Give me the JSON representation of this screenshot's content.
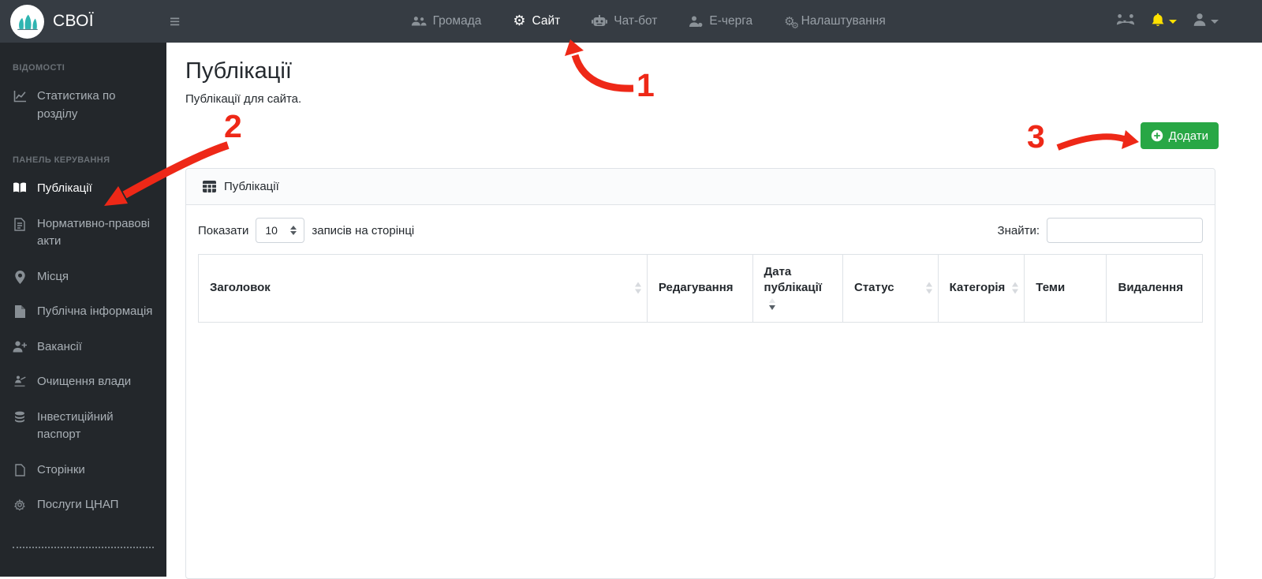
{
  "navbar": {
    "brand": "СВОЇ",
    "items": [
      {
        "label": "Громада",
        "icon": "people-icon",
        "active": false
      },
      {
        "label": "Сайт",
        "icon": "gear-icon",
        "active": true
      },
      {
        "label": "Чат-бот",
        "icon": "robot-icon",
        "active": false
      },
      {
        "label": "Е-черга",
        "icon": "queue-person-icon",
        "active": false
      },
      {
        "label": "Налаштування",
        "icon": "gears-icon",
        "active": false
      }
    ],
    "right_icons": [
      "handshake-icon",
      "bell-icon",
      "user-icon"
    ]
  },
  "sidebar": {
    "sections": [
      {
        "heading": "ВІДОМОСТІ",
        "items": [
          {
            "label": "Статистика по розділу",
            "icon": "chart-line-icon",
            "active": false
          }
        ]
      },
      {
        "heading": "ПАНЕЛЬ КЕРУВАННЯ",
        "items": [
          {
            "label": "Публікації",
            "icon": "book-icon",
            "active": true
          },
          {
            "label": "Нормативно-правові акти",
            "icon": "legal-doc-icon",
            "active": false
          },
          {
            "label": "Місця",
            "icon": "map-pin-icon",
            "active": false
          },
          {
            "label": "Публічна інформація",
            "icon": "public-info-icon",
            "active": false
          },
          {
            "label": "Вакансії",
            "icon": "user-plus-icon",
            "active": false
          },
          {
            "label": "Очищення влади",
            "icon": "lustration-icon",
            "active": false
          },
          {
            "label": "Інвестиційний паспорт",
            "icon": "coins-icon",
            "active": false
          },
          {
            "label": "Сторінки",
            "icon": "page-icon",
            "active": false
          },
          {
            "label": "Послуги ЦНАП",
            "icon": "services-icon",
            "active": false
          }
        ]
      }
    ]
  },
  "main": {
    "title": "Публікації",
    "subtitle": "Публікації для сайта.",
    "add_button": {
      "label": "Додати",
      "icon": "plus-circle-icon",
      "color": "#28a745"
    },
    "panel": {
      "header": {
        "label": "Публікації",
        "icon": "table-icon"
      },
      "length_control": {
        "prefix": "Показати",
        "value": "10",
        "suffix": "записів на сторінці"
      },
      "search": {
        "label": "Знайти:",
        "value": "",
        "placeholder": ""
      },
      "table": {
        "columns": [
          {
            "label": "Заголовок",
            "sort": "both"
          },
          {
            "label": "Редагування",
            "sort": "none"
          },
          {
            "label": "Дата публікації",
            "sort": "desc"
          },
          {
            "label": "Статус",
            "sort": "both"
          },
          {
            "label": "Категорія",
            "sort": "both"
          },
          {
            "label": "Теми",
            "sort": "none"
          },
          {
            "label": "Видалення",
            "sort": "none"
          }
        ],
        "rows": []
      }
    }
  },
  "annotations": {
    "steps": [
      {
        "label": "1",
        "target": "nav-item-sait"
      },
      {
        "label": "2",
        "target": "sidebar-item-publikatsii"
      },
      {
        "label": "3",
        "target": "add-button"
      }
    ],
    "color": "#ee2817"
  },
  "colors": {
    "navbar_bg": "#363c43",
    "sidebar_bg": "#23272b",
    "accent_green": "#28a745",
    "bell_yellow": "#ffe100",
    "annotation_red": "#ee2817",
    "logo_teal": "#2fb5b1"
  }
}
